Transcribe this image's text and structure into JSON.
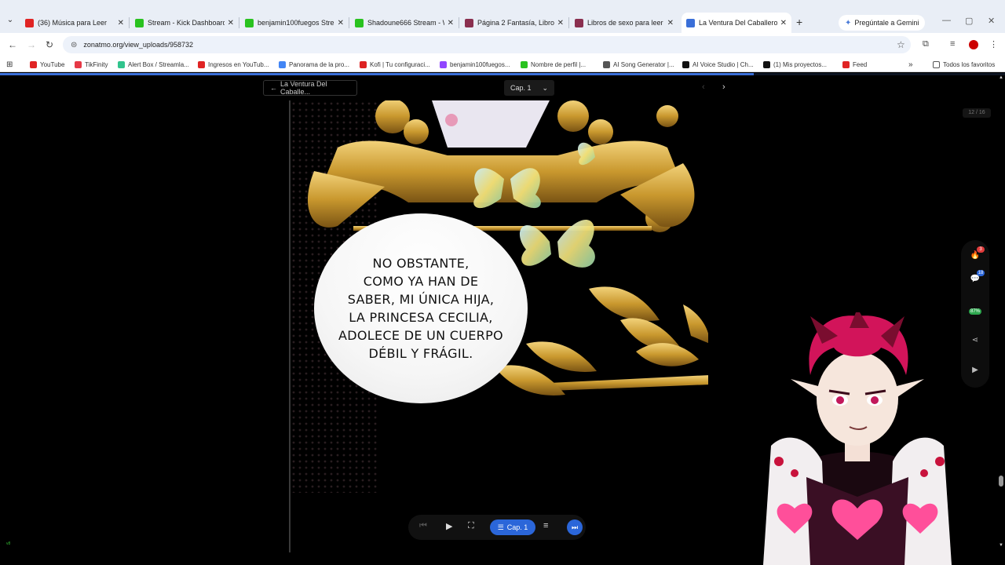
{
  "browser": {
    "tabs": [
      {
        "title": "(36) Música para Leer",
        "icon_color": "#e02424",
        "active": false
      },
      {
        "title": "Stream - Kick Dashboard",
        "icon_color": "#29c21f",
        "active": false
      },
      {
        "title": "benjamin100fuegos Strea...",
        "icon_color": "#29c21f",
        "active": false
      },
      {
        "title": "Shadoune666 Stream - Wi...",
        "icon_color": "#29c21f",
        "active": false
      },
      {
        "title": "Página 2 Fantasía, Libros d...",
        "icon_color": "#8a2f4f",
        "active": false
      },
      {
        "title": "Libros de sexo para leer o...",
        "icon_color": "#8a2f4f",
        "active": false
      },
      {
        "title": "La Ventura Del Caballero ...",
        "icon_color": "#3a6fd8",
        "active": true
      }
    ],
    "gemini_label": "Pregúntale a Gemini",
    "url": "zonatmo.org/view_uploads/958732",
    "bookmarks": [
      {
        "label": "YouTube",
        "icon_color": "#e02424"
      },
      {
        "label": "TikFinity",
        "icon_color": "#e63946"
      },
      {
        "label": "Alert Box / Streamla...",
        "icon_color": "#31c48d"
      },
      {
        "label": "Ingresos en YouTub...",
        "icon_color": "#e02424"
      },
      {
        "label": "Panorama de la pro...",
        "icon_color": "#4285f4"
      },
      {
        "label": "Kofi | Tu configuraci...",
        "icon_color": "#d22"
      },
      {
        "label": "benjamin100fuegos...",
        "icon_color": "#9146ff"
      },
      {
        "label": "Nombre de perfil |...",
        "icon_color": "#29c21f"
      },
      {
        "label": "AI Song Generator |...",
        "icon_color": "#555"
      },
      {
        "label": "AI Voice Studio | Ch...",
        "icon_color": "#111"
      },
      {
        "label": "(1) Mis proyectos...",
        "icon_color": "#111"
      },
      {
        "label": "Feed",
        "icon_color": "#e02424"
      }
    ],
    "all_bookmarks_label": "Todos los favoritos"
  },
  "reader": {
    "back_label": "La Ventura Del Caballe...",
    "chapter_select": "Cap. 1",
    "page_counter": "12 / 16",
    "progress_fraction": 0.75,
    "bubble_lines": [
      "NO OBSTANTE,",
      "COMO YA HAN DE",
      "SABER, MI ÚNICA HIJA,",
      "LA PRINCESA CECILIA,",
      "ADOLECE DE UN CUERPO",
      "DÉBIL Y FRÁGIL."
    ],
    "side_badges": {
      "fire": "3",
      "comments": "18",
      "percent": "87%"
    },
    "controls": {
      "chapter_button": "Cap. 1"
    }
  },
  "overlay": {
    "corner_tag": "v8"
  }
}
